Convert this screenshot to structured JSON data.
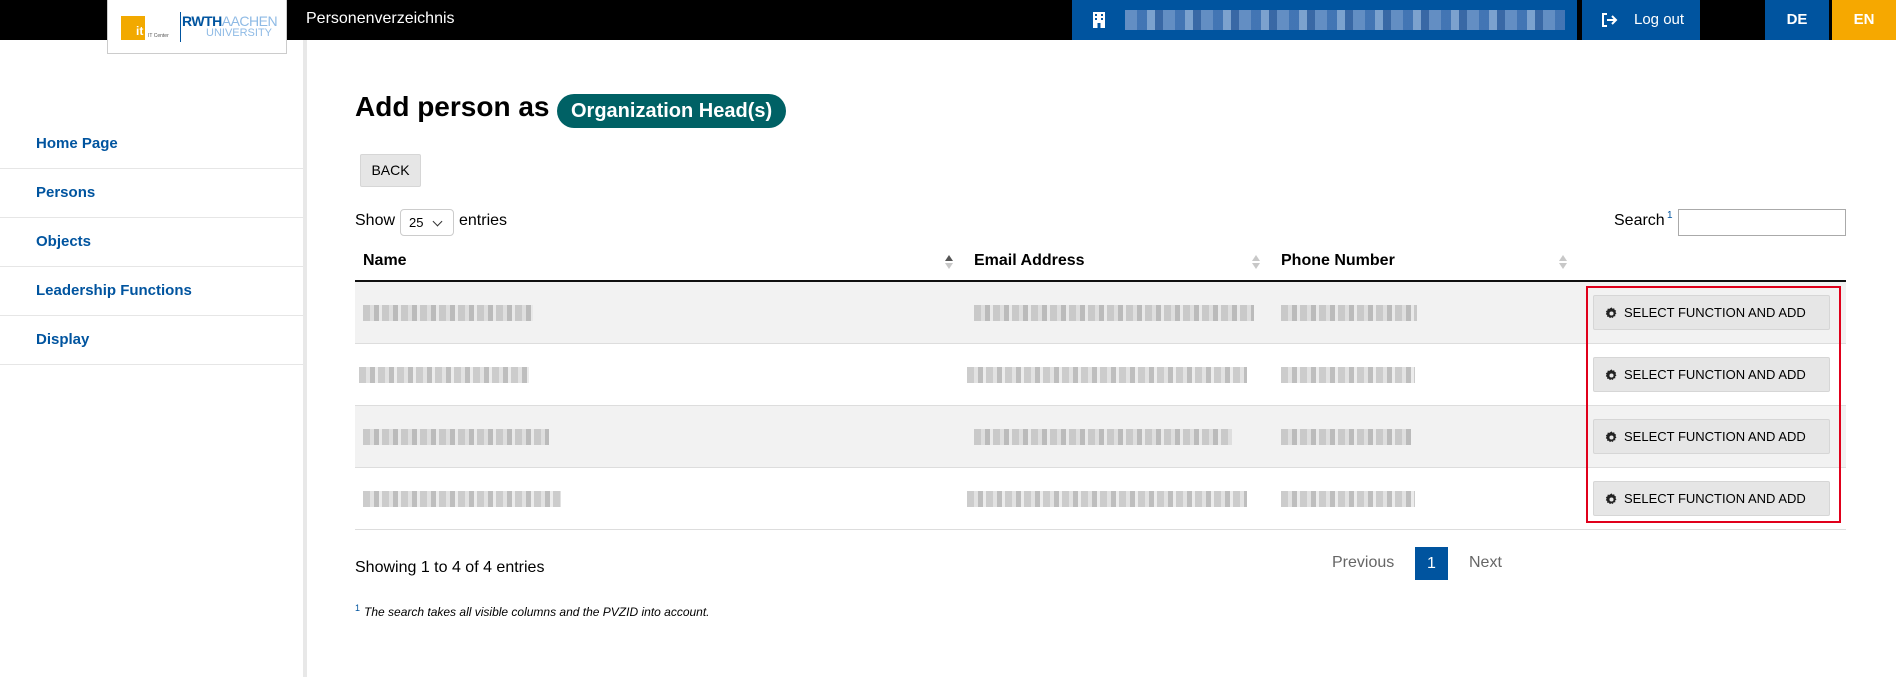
{
  "header": {
    "app_title": "Personenverzeichnis",
    "logo_it": "it",
    "logo_it_sub": "IT Center",
    "logo_rwth": "RWTH",
    "logo_aachen": "AACHEN",
    "logo_university": "UNIVERSITY",
    "logout_label": "Log out",
    "lang_de": "DE",
    "lang_en": "EN"
  },
  "sidebar": {
    "items": [
      {
        "label": "Home Page"
      },
      {
        "label": "Persons"
      },
      {
        "label": "Objects"
      },
      {
        "label": "Leadership Functions"
      },
      {
        "label": "Display"
      }
    ]
  },
  "main": {
    "heading": "Add person as",
    "role_badge": "Organization Head(s)",
    "back_label": "BACK",
    "show_label": "Show",
    "page_size": "25",
    "entries_label": "entries",
    "search_label": "Search",
    "search_footnote_mark": "1",
    "search_value": ""
  },
  "table": {
    "columns": [
      "Name",
      "Email Address",
      "Phone Number",
      ""
    ],
    "action_label": "SELECT FUNCTION AND ADD",
    "row_count": 4
  },
  "footer": {
    "info": "Showing 1 to 4 of 4 entries",
    "previous": "Previous",
    "current_page": "1",
    "next": "Next",
    "footnote_mark": "1",
    "footnote": "The search takes all visible columns and the PVZID into account."
  },
  "colors": {
    "rwth_blue": "#00549f",
    "badge_teal": "#006165",
    "accent_yellow": "#f6a800",
    "highlight_red": "#e0001b"
  }
}
